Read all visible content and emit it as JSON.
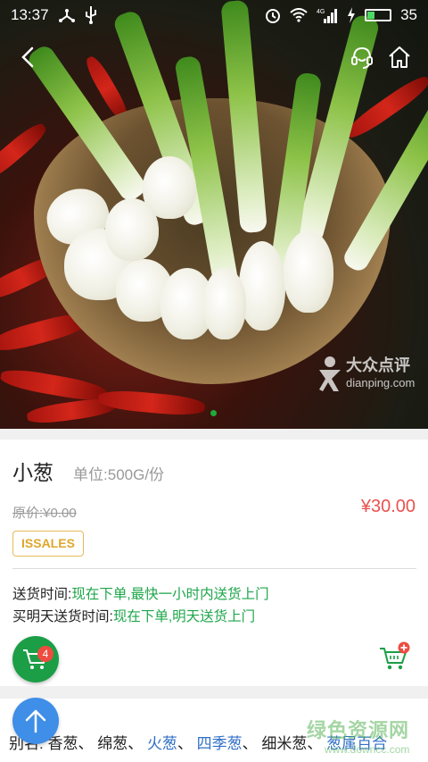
{
  "status_bar": {
    "time": "13:37",
    "battery_level": 35,
    "battery_text": "35",
    "network": "4G"
  },
  "hero": {
    "watermark_cn": "大众点评",
    "watermark_en": "dianping.com",
    "carousel_index": 1,
    "carousel_total": 1
  },
  "product": {
    "name": "小葱",
    "unit_label": "单位:",
    "unit": "500G/份",
    "original_price": "原价:¥0.00",
    "price": "¥30.00",
    "badge": "ISSALES"
  },
  "delivery": {
    "now_label": "送货时间:",
    "now_value": "现在下单,最快一小时内送货上门",
    "tomorrow_label": "买明天送货时间:",
    "tomorrow_value": "现在下单,明天送货上门"
  },
  "cart": {
    "count": "4"
  },
  "alias": {
    "label": "别名:",
    "names": [
      "香葱",
      "绵葱",
      "火葱",
      "四季葱",
      "细米葱",
      "葱属百合"
    ],
    "separator": "、"
  },
  "corner_watermark": {
    "title": "绿色资源网",
    "url": "www.downcc.com"
  },
  "colors": {
    "accent_green": "#1c9e47",
    "price_red": "#e8524f",
    "badge_orange": "#e0a62b",
    "link_blue": "#2f6fc6",
    "fab_blue": "#3f8ee8"
  }
}
